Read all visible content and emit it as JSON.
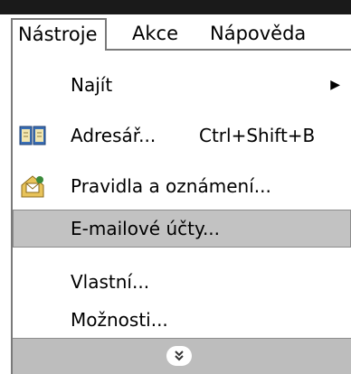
{
  "menubar": {
    "items": [
      {
        "label": "Nástroje"
      },
      {
        "label": "Akce"
      },
      {
        "label": "Nápověda"
      }
    ]
  },
  "menu": {
    "items": [
      {
        "label": "Najít",
        "shortcut": "",
        "submenu": true,
        "icon": ""
      },
      {
        "label": "Adresář...",
        "shortcut": "Ctrl+Shift+B",
        "submenu": false,
        "icon": "address-book-icon"
      },
      {
        "label": "Pravidla a oznámení...",
        "shortcut": "",
        "submenu": false,
        "icon": "rules-icon"
      },
      {
        "label": "E-mailové účty...",
        "shortcut": "",
        "submenu": false,
        "icon": "",
        "highlighted": true
      },
      {
        "label": "Vlastní...",
        "shortcut": "",
        "submenu": false,
        "icon": ""
      },
      {
        "label": "Možnosti...",
        "shortcut": "",
        "submenu": false,
        "icon": ""
      }
    ],
    "expander_glyph": "»",
    "highlight_color": "#c2c2c2"
  }
}
